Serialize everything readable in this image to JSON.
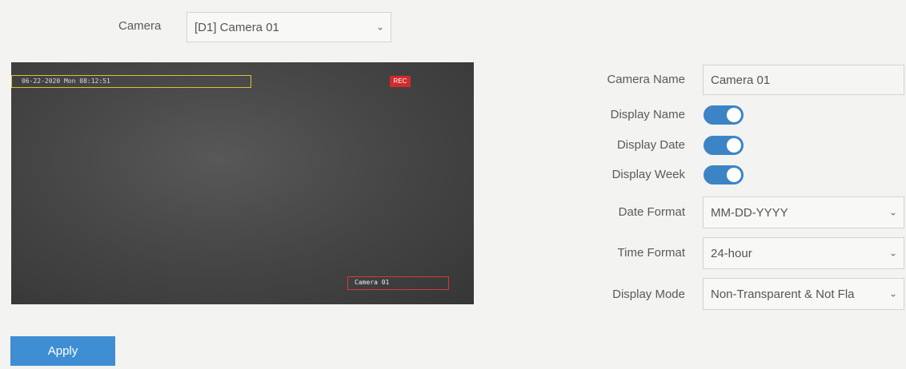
{
  "camera_select": {
    "label": "Camera",
    "value": "[D1] Camera 01"
  },
  "preview": {
    "osd_datetime": "06-22-2020 Mon 08:12:51",
    "osd_icon": "REC",
    "osd_camera_name": "Camera 01"
  },
  "settings": {
    "camera_name_label": "Camera Name",
    "camera_name_value": "Camera 01",
    "display_name_label": "Display Name",
    "display_name_on": true,
    "display_date_label": "Display Date",
    "display_date_on": true,
    "display_week_label": "Display Week",
    "display_week_on": true,
    "date_format_label": "Date Format",
    "date_format_value": "MM-DD-YYYY",
    "time_format_label": "Time Format",
    "time_format_value": "24-hour",
    "display_mode_label": "Display Mode",
    "display_mode_value": "Non-Transparent & Not Fla"
  },
  "apply_label": "Apply",
  "colors": {
    "accent": "#3f8ed4",
    "toggle_on": "#3d84c6",
    "osd_date_border": "#d6c23a",
    "osd_name_border": "#d43a3a"
  }
}
